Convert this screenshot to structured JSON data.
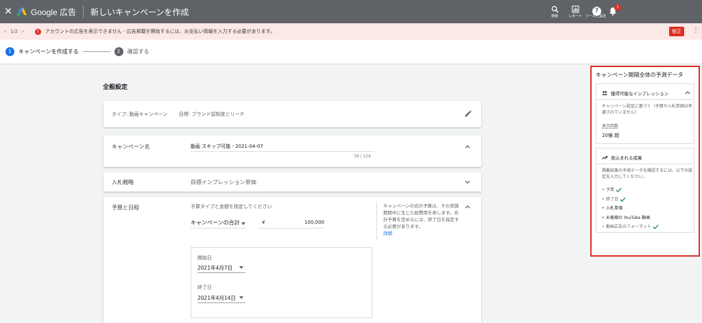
{
  "topbar": {
    "brand": "Google 広告",
    "title": "新しいキャンペーンを作成",
    "tools": [
      {
        "label": "検索",
        "icon": "search-icon"
      },
      {
        "label": "レポート",
        "icon": "bar-chart-icon"
      },
      {
        "label": "ツールと設定",
        "icon": "wrench-icon"
      }
    ],
    "help_glyph": "?",
    "notification_count": "1"
  },
  "alert": {
    "pager": "1/2",
    "message": "アカウントの広告を表示できません - 広告掲載を開始するには、お支払い情報を入力する必要があります。",
    "fix_label": "修正",
    "error_glyph": "!"
  },
  "stepper": {
    "steps": [
      {
        "num": "1",
        "label": "キャンペーンを作成する"
      },
      {
        "num": "2",
        "label": "確認する"
      }
    ]
  },
  "main": {
    "section_title": "全般設定",
    "type_text": "タイプ: 動画キャンペーン",
    "goal_text": "目標: ブランド認知度とリーチ",
    "campaign_name_label": "キャンペーン名",
    "campaign_name_value": "動画 スキップ可能 - 2021-04-07",
    "campaign_name_count": "38 / 128",
    "bidding_label": "入札戦略",
    "bidding_value": "目標インプレッション単価",
    "budget_label": "予算と日程",
    "budget_prompt": "予算タイプと金額を指定してください",
    "budget_type": "キャンペーンの合計",
    "currency": "¥",
    "amount": "100,000",
    "budget_note": "キャンペーンの合計予算は、その実施期間中に生じた総費用を表します。合計予算を定めるには、終了日を指定する必要があります。",
    "budget_note_link": "詳細",
    "start_label": "開始日",
    "start_value": "2021年4月7日",
    "end_label": "終了日",
    "end_value": "2021年4月14日"
  },
  "forecast": {
    "title": "キャンペーン期間全体の予測データ",
    "impressions_header": "獲得可能なインプレッション",
    "impressions_note": "キャンペーン設定に基づく（予算や入札単価は考慮されていません）",
    "impressions_label": "表示回数",
    "impressions_value": "20億 超",
    "results_header": "見込まれる成果",
    "results_note": "掲載結果の予測データを確認するには、以下の設定を入力してください。",
    "items": [
      {
        "label": "予算",
        "done": true
      },
      {
        "label": "終了日",
        "done": true
      },
      {
        "label": "入札単価",
        "done": false
      },
      {
        "label": "お客様の YouTube 動画",
        "done": false
      },
      {
        "label": "動画広告のフォーマット",
        "done": true
      }
    ]
  },
  "colors": {
    "topbar": "#5f6368",
    "accent": "#1a73e8",
    "error": "#d93025",
    "success": "#1e8e3e"
  }
}
